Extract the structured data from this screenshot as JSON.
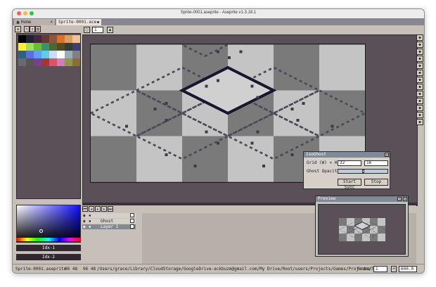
{
  "window": {
    "title": "Sprite-0001.aseprite - Aseprite v1.3.18.1",
    "traffic_lights": [
      "#ff5f57",
      "#febc2e",
      "#28c840"
    ]
  },
  "tabs": [
    {
      "label": "Home",
      "icon": "home-icon",
      "active": false
    },
    {
      "label": "Sprite-0001.ace",
      "active": true
    }
  ],
  "toolbar": {
    "brush_size": "1"
  },
  "palette": {
    "colors": [
      "#000000",
      "#222034",
      "#45283c",
      "#663931",
      "#8f563b",
      "#df7126",
      "#d9a066",
      "#eec39a",
      "#fbf236",
      "#99e550",
      "#6abe30",
      "#37946e",
      "#4b692f",
      "#524b24",
      "#323c39",
      "#3f3f74",
      "#306082",
      "#5b6ee1",
      "#639bff",
      "#5fcde4",
      "#cbdbfc",
      "#ffffff",
      "#9badb7",
      "#847e87",
      "#696a6a",
      "#595652",
      "#76428a",
      "#ac3232",
      "#d95763",
      "#d77bba",
      "#8f974a",
      "#8a6f30"
    ]
  },
  "color_bars": {
    "foreground": "Idx-1",
    "background": "Idx-2"
  },
  "timeline": {
    "layers": [
      {
        "name": "",
        "icon": "layer-group-icon"
      },
      {
        "name": "Ghost"
      },
      {
        "name": "Layer 1",
        "selected": true
      }
    ]
  },
  "isoghost": {
    "title": "IsoGhost",
    "grid_label": "Grid (W) × H):",
    "grid_w": "32",
    "grid_h": "16",
    "opacity_label": "Ghost Opacity:",
    "opacity": 0.5,
    "start_label": "Start Sync",
    "stop_label": "Stop"
  },
  "preview": {
    "title": "Preview"
  },
  "status": {
    "sprite_name": "Sprite-0001.aseprite",
    "size": "96 48",
    "cursor": "96 48",
    "path": "/Users/grace/Library/CloudStorage/GoogleDrive-ackbuzm@gmail.com/My Drive/Root/users/Projects/Games/Projects/Things",
    "frame_label": "Frame:",
    "frame": "1",
    "zoom": "600.0"
  }
}
